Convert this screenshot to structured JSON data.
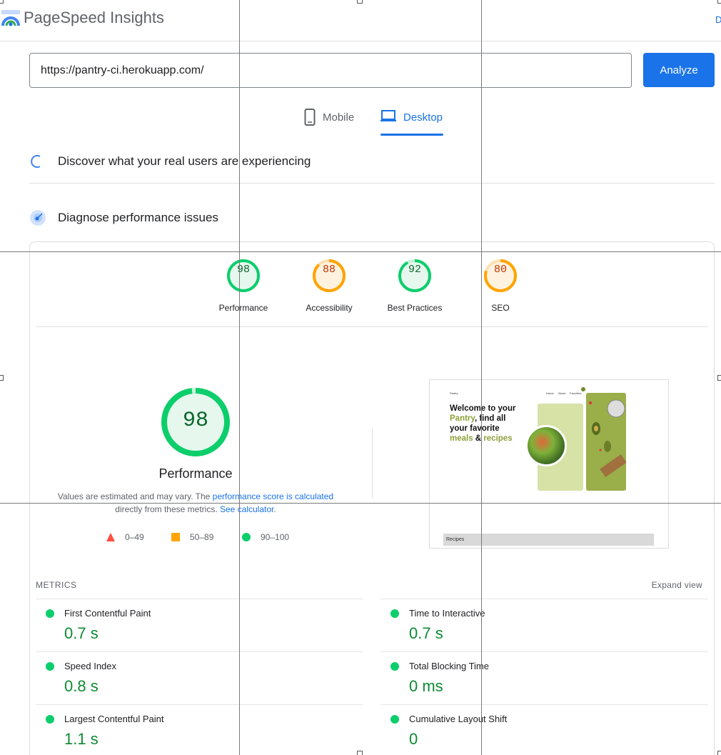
{
  "header": {
    "brand": "PageSpeed Insights",
    "right_link": "D"
  },
  "search": {
    "url": "https://pantry-ci.herokuapp.com/",
    "analyze_label": "Analyze"
  },
  "tabs": [
    {
      "label": "Mobile"
    },
    {
      "label": "Desktop"
    }
  ],
  "sections": {
    "real_users": "Discover what your real users are experiencing",
    "diagnose": "Diagnose performance issues"
  },
  "scores": [
    {
      "value": "98",
      "label": "Performance",
      "color": "#0cce6b"
    },
    {
      "value": "88",
      "label": "Accessibility",
      "color": "#ffa400"
    },
    {
      "value": "92",
      "label": "Best Practices",
      "color": "#0cce6b"
    },
    {
      "value": "80",
      "label": "SEO",
      "color": "#ffa400"
    }
  ],
  "performance": {
    "score": "98",
    "label": "Performance",
    "desc_prefix": "Values are estimated and may vary. The ",
    "desc_link": "performance score is calculated",
    "desc_middle": "directly from these metrics. ",
    "desc_link2": "See calculator",
    "desc_end": "."
  },
  "legend": [
    {
      "range": "0–49",
      "color": "#ff4e42"
    },
    {
      "range": "50–89",
      "color": "#ffa400"
    },
    {
      "range": "90–100",
      "color": "#0cce6b"
    }
  ],
  "screenshot": {
    "site_name": "Pantry",
    "nav": [
      "Home",
      "About",
      "Favorites"
    ],
    "hero_line1": "Welcome to your",
    "hero_pantry": "Pantry",
    "hero_line2_rest": ", find all",
    "hero_line3": "your favorite",
    "hero_meals": "meals",
    "hero_amp": " & ",
    "hero_recipes": "recipes",
    "recipes_bar": "Recipes"
  },
  "metrics": {
    "title": "METRICS",
    "expand_label": "Expand view",
    "items": [
      {
        "name": "First Contentful Paint",
        "value": "0.7 s"
      },
      {
        "name": "Time to Interactive",
        "value": "0.7 s"
      },
      {
        "name": "Speed Index",
        "value": "0.8 s"
      },
      {
        "name": "Total Blocking Time",
        "value": "0 ms"
      },
      {
        "name": "Largest Contentful Paint",
        "value": "1.1 s"
      },
      {
        "name": "Cumulative Layout Shift",
        "value": "0"
      }
    ]
  },
  "colors": {
    "accent": "#1a73e8",
    "pass": "#0cce6b",
    "average": "#ffa400",
    "fail": "#ff4e42"
  }
}
